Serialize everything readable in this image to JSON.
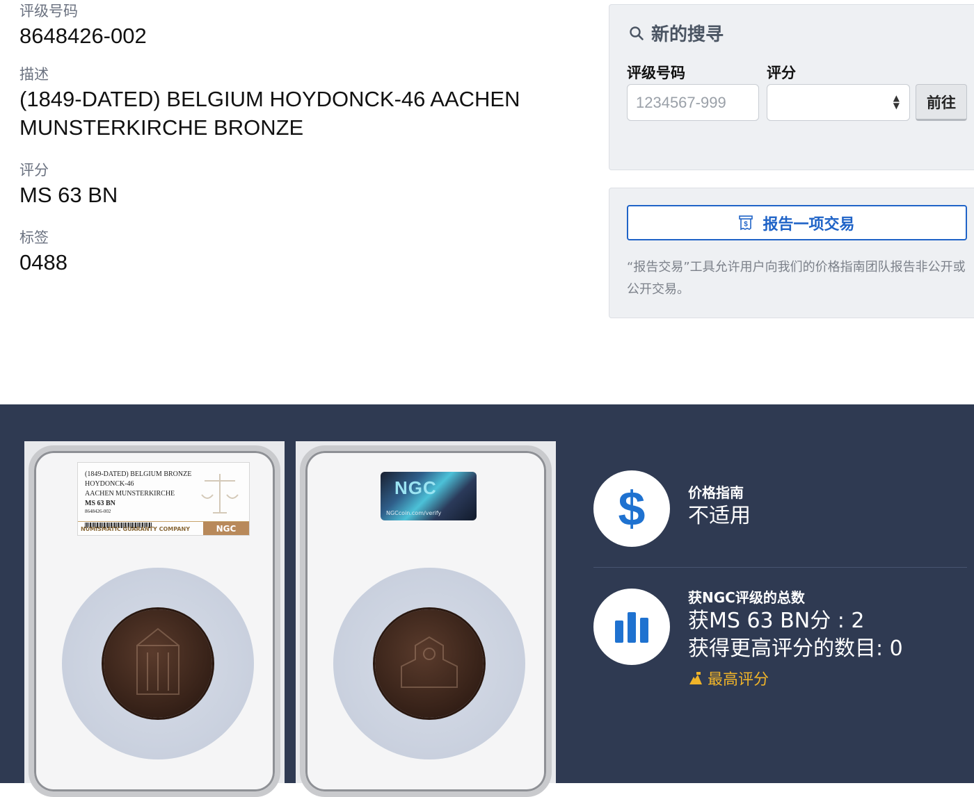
{
  "details": {
    "cert_label": "评级号码",
    "cert_value": "8648426-002",
    "desc_label": "描述",
    "desc_value": "(1849-DATED) BELGIUM HOYDONCK-46 AACHEN MUNSTERKIRCHE BRONZE",
    "grade_label": "评分",
    "grade_value": "MS 63 BN",
    "label_label": "标签",
    "label_value": "0488"
  },
  "search": {
    "title": "新的搜寻",
    "cert_label": "评级号码",
    "cert_placeholder": "1234567-999",
    "grade_label": "评分",
    "grade_value": "",
    "go_label": "前往"
  },
  "report": {
    "button_label": "报告一项交易",
    "description": "“报告交易”工具允许用户向我们的价格指南团队报告非公开或公开交易。"
  },
  "slab_label": {
    "line1": "(1849-DATED) BELGIUM BRONZE",
    "line2": "HOYDONCK-46",
    "line3": "AACHEN MUNSTERKIRCHE",
    "line4": "MS 63 BN",
    "line5": "8648426-002",
    "company": "NUMISMATIC GUARANTY COMPANY",
    "brand": "NGC"
  },
  "slab_back": {
    "holo_text": "NGC",
    "holo_url": "NGCcoin.com/verify"
  },
  "price_guide": {
    "label": "价格指南",
    "value": "不适用"
  },
  "population": {
    "label": "获NGC评级的总数",
    "at_grade": "获MS 63 BN分 : 2",
    "higher": "获得更高评分的数目: 0",
    "top_grade": "最高评分"
  },
  "colors": {
    "accent_blue": "#1f63c7",
    "dark_bg": "#2f3a52",
    "gold": "#f0b429"
  },
  "icons": [
    "search-icon",
    "receipt-icon",
    "dollar-icon",
    "bar-chart-icon",
    "trophy-icon"
  ]
}
